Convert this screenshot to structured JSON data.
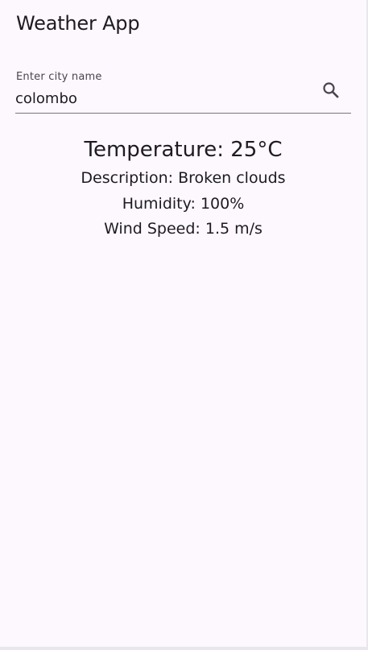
{
  "app": {
    "title": "Weather App"
  },
  "search": {
    "label": "Enter city name",
    "value": "colombo",
    "icon": "search-icon"
  },
  "weather": {
    "temperature_label": "Temperature: ",
    "temperature_value": "25°C",
    "description_label": "Description: ",
    "description_value": "Broken clouds",
    "humidity_label": "Humidity: ",
    "humidity_value": "100%",
    "wind_label": "Wind Speed: ",
    "wind_value": "1.5 m/s"
  },
  "colors": {
    "background": "#fdf7fe",
    "text": "#1d1b20",
    "label": "#49454f",
    "underline": "#79747e"
  }
}
